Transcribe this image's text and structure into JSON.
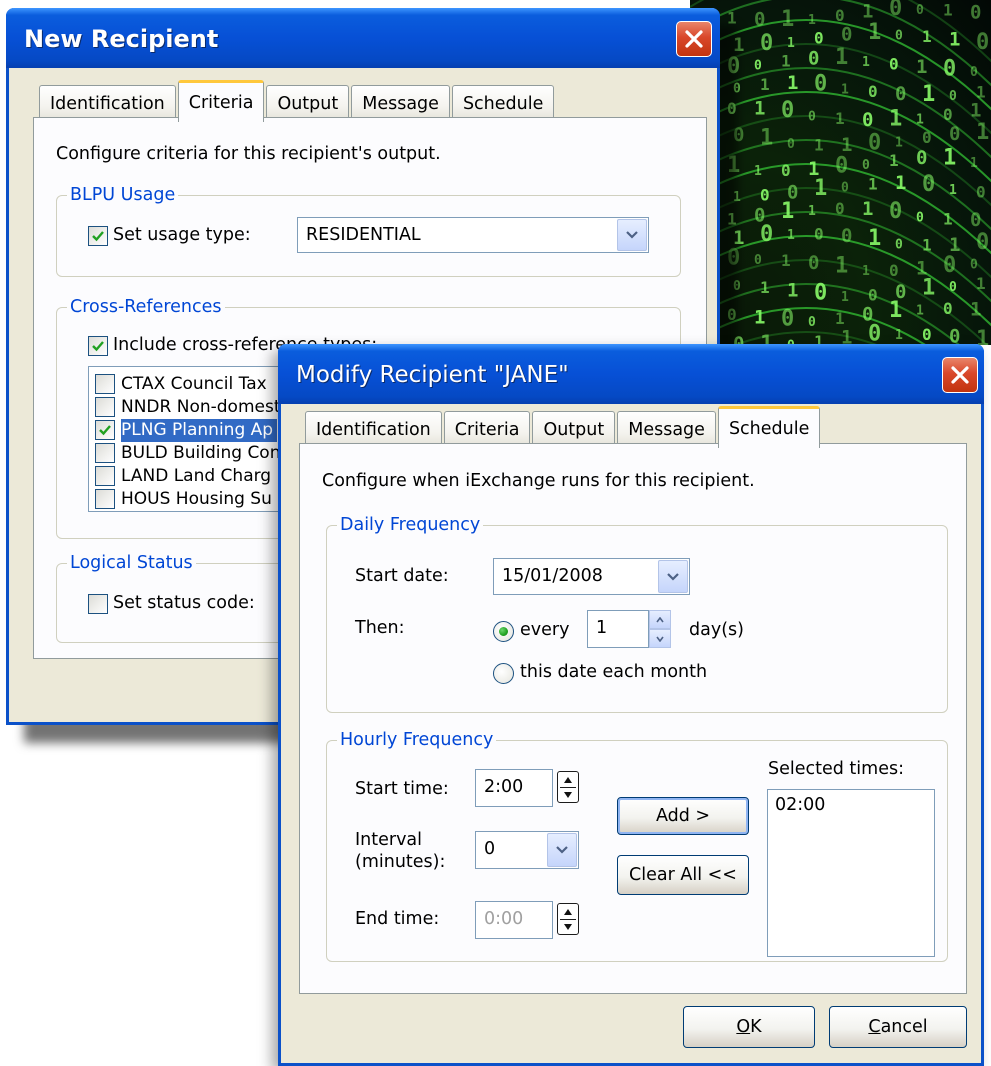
{
  "background": {
    "matrix_text": "010110100101101001011010"
  },
  "new_recipient": {
    "title": "New Recipient",
    "tabs": [
      "Identification",
      "Criteria",
      "Output",
      "Message",
      "Schedule"
    ],
    "active_tab": "Criteria",
    "intro": "Configure criteria for this recipient's output.",
    "blpu": {
      "group_title": "BLPU Usage",
      "checkbox_label": "Set usage type:",
      "checked": true,
      "value": "RESIDENTIAL"
    },
    "xref": {
      "group_title": "Cross-References",
      "checkbox_label": "Include cross-reference types:",
      "checked": true,
      "items": [
        {
          "label": "CTAX Council Tax",
          "checked": false
        },
        {
          "label": "NNDR Non-domestic",
          "checked": false
        },
        {
          "label": "PLNG Planning Ap",
          "checked": true,
          "selected": true
        },
        {
          "label": "BULD Building Con",
          "checked": false
        },
        {
          "label": "LAND Land Charg",
          "checked": false
        },
        {
          "label": "HOUS Housing Su",
          "checked": false
        }
      ]
    },
    "logical": {
      "group_title": "Logical Status",
      "checkbox_label": "Set status code:",
      "checked": false
    }
  },
  "modify_recipient": {
    "title": "Modify Recipient \"JANE\"",
    "tabs": [
      "Identification",
      "Criteria",
      "Output",
      "Message",
      "Schedule"
    ],
    "active_tab": "Schedule",
    "intro": "Configure when iExchange runs for this recipient.",
    "daily": {
      "group_title": "Daily Frequency",
      "start_date_label": "Start date:",
      "start_date_value": "15/01/2008",
      "then_label": "Then:",
      "every_label": "every",
      "every_value": "1",
      "every_unit": "day(s)",
      "monthly_label": "this date each month",
      "selected_option": "every"
    },
    "hourly": {
      "group_title": "Hourly Frequency",
      "start_time_label": "Start time:",
      "start_time_value": "2:00",
      "interval_label_1": "Interval",
      "interval_label_2": "(minutes):",
      "interval_value": "0",
      "end_time_label": "End time:",
      "end_time_value": "0:00",
      "add_label": "Add >",
      "clear_label": "Clear All <<",
      "selected_times_label": "Selected times:",
      "selected_times": [
        "02:00"
      ]
    },
    "buttons": {
      "ok_mnemonic": "O",
      "ok_rest": "K",
      "cancel_mnemonic": "C",
      "cancel_rest": "ancel"
    }
  }
}
